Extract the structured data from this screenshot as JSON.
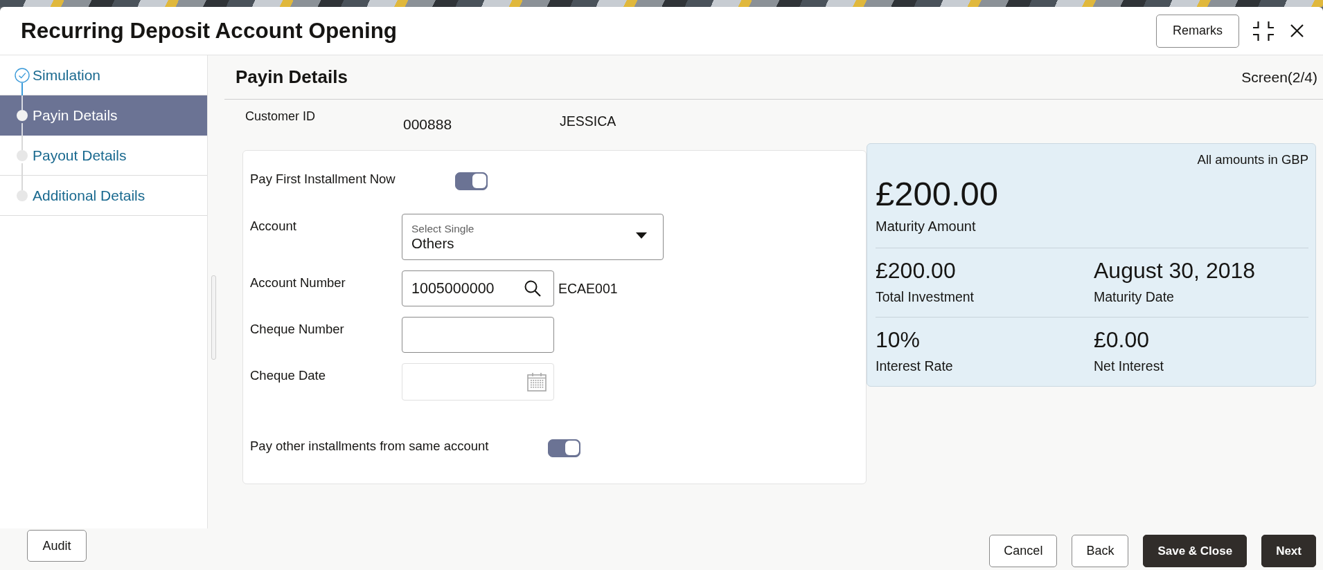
{
  "window": {
    "title": "Recurring Deposit Account Opening",
    "remarks_button": "Remarks"
  },
  "sidebar": {
    "items": [
      {
        "label": "Simulation",
        "completed": true,
        "selected": false
      },
      {
        "label": "Payin Details",
        "completed": false,
        "selected": true
      },
      {
        "label": "Payout Details",
        "completed": false,
        "selected": false
      },
      {
        "label": "Additional Details",
        "completed": false,
        "selected": false
      }
    ]
  },
  "page": {
    "heading": "Payin Details",
    "screen_indicator": "Screen(2/4)"
  },
  "customer": {
    "label": "Customer ID",
    "id": "000888",
    "name": "JESSICA"
  },
  "form": {
    "fields": [
      {
        "kind": "toggle",
        "label": "Pay First Installment Now",
        "on": true,
        "disabled": false
      },
      {
        "kind": "select",
        "label": "Account",
        "field_label": "Select Single",
        "value": "Others",
        "disabled": false
      },
      {
        "kind": "lookup",
        "label": "Account Number",
        "value": "1005000000",
        "suffix": "ECAE001",
        "disabled": false
      },
      {
        "kind": "text",
        "label": "Cheque Number",
        "disabled": false
      },
      {
        "kind": "date",
        "label": "Cheque Date",
        "disabled": true
      },
      {
        "kind": "toggle",
        "label": "Pay other installments from same account",
        "on": true,
        "disabled": false
      }
    ]
  },
  "summary": {
    "note": "All amounts in GBP",
    "headline": {
      "value": "£200.00",
      "label": "Maturity Amount"
    },
    "metrics": [
      {
        "value": "£200.00",
        "label": "Total Investment"
      },
      {
        "value": "August 30, 2018",
        "label": "Maturity Date"
      },
      {
        "value": "10%",
        "label": "Interest Rate"
      },
      {
        "value": "£0.00",
        "label": "Net Interest"
      }
    ]
  },
  "footer": {
    "left_buttons": [
      {
        "label": "Audit",
        "primary": false
      }
    ],
    "right_buttons": [
      {
        "label": "Cancel",
        "primary": false
      },
      {
        "label": "Back",
        "primary": false
      },
      {
        "label": "Save & Close",
        "primary": true
      },
      {
        "label": "Next",
        "primary": true
      }
    ]
  }
}
